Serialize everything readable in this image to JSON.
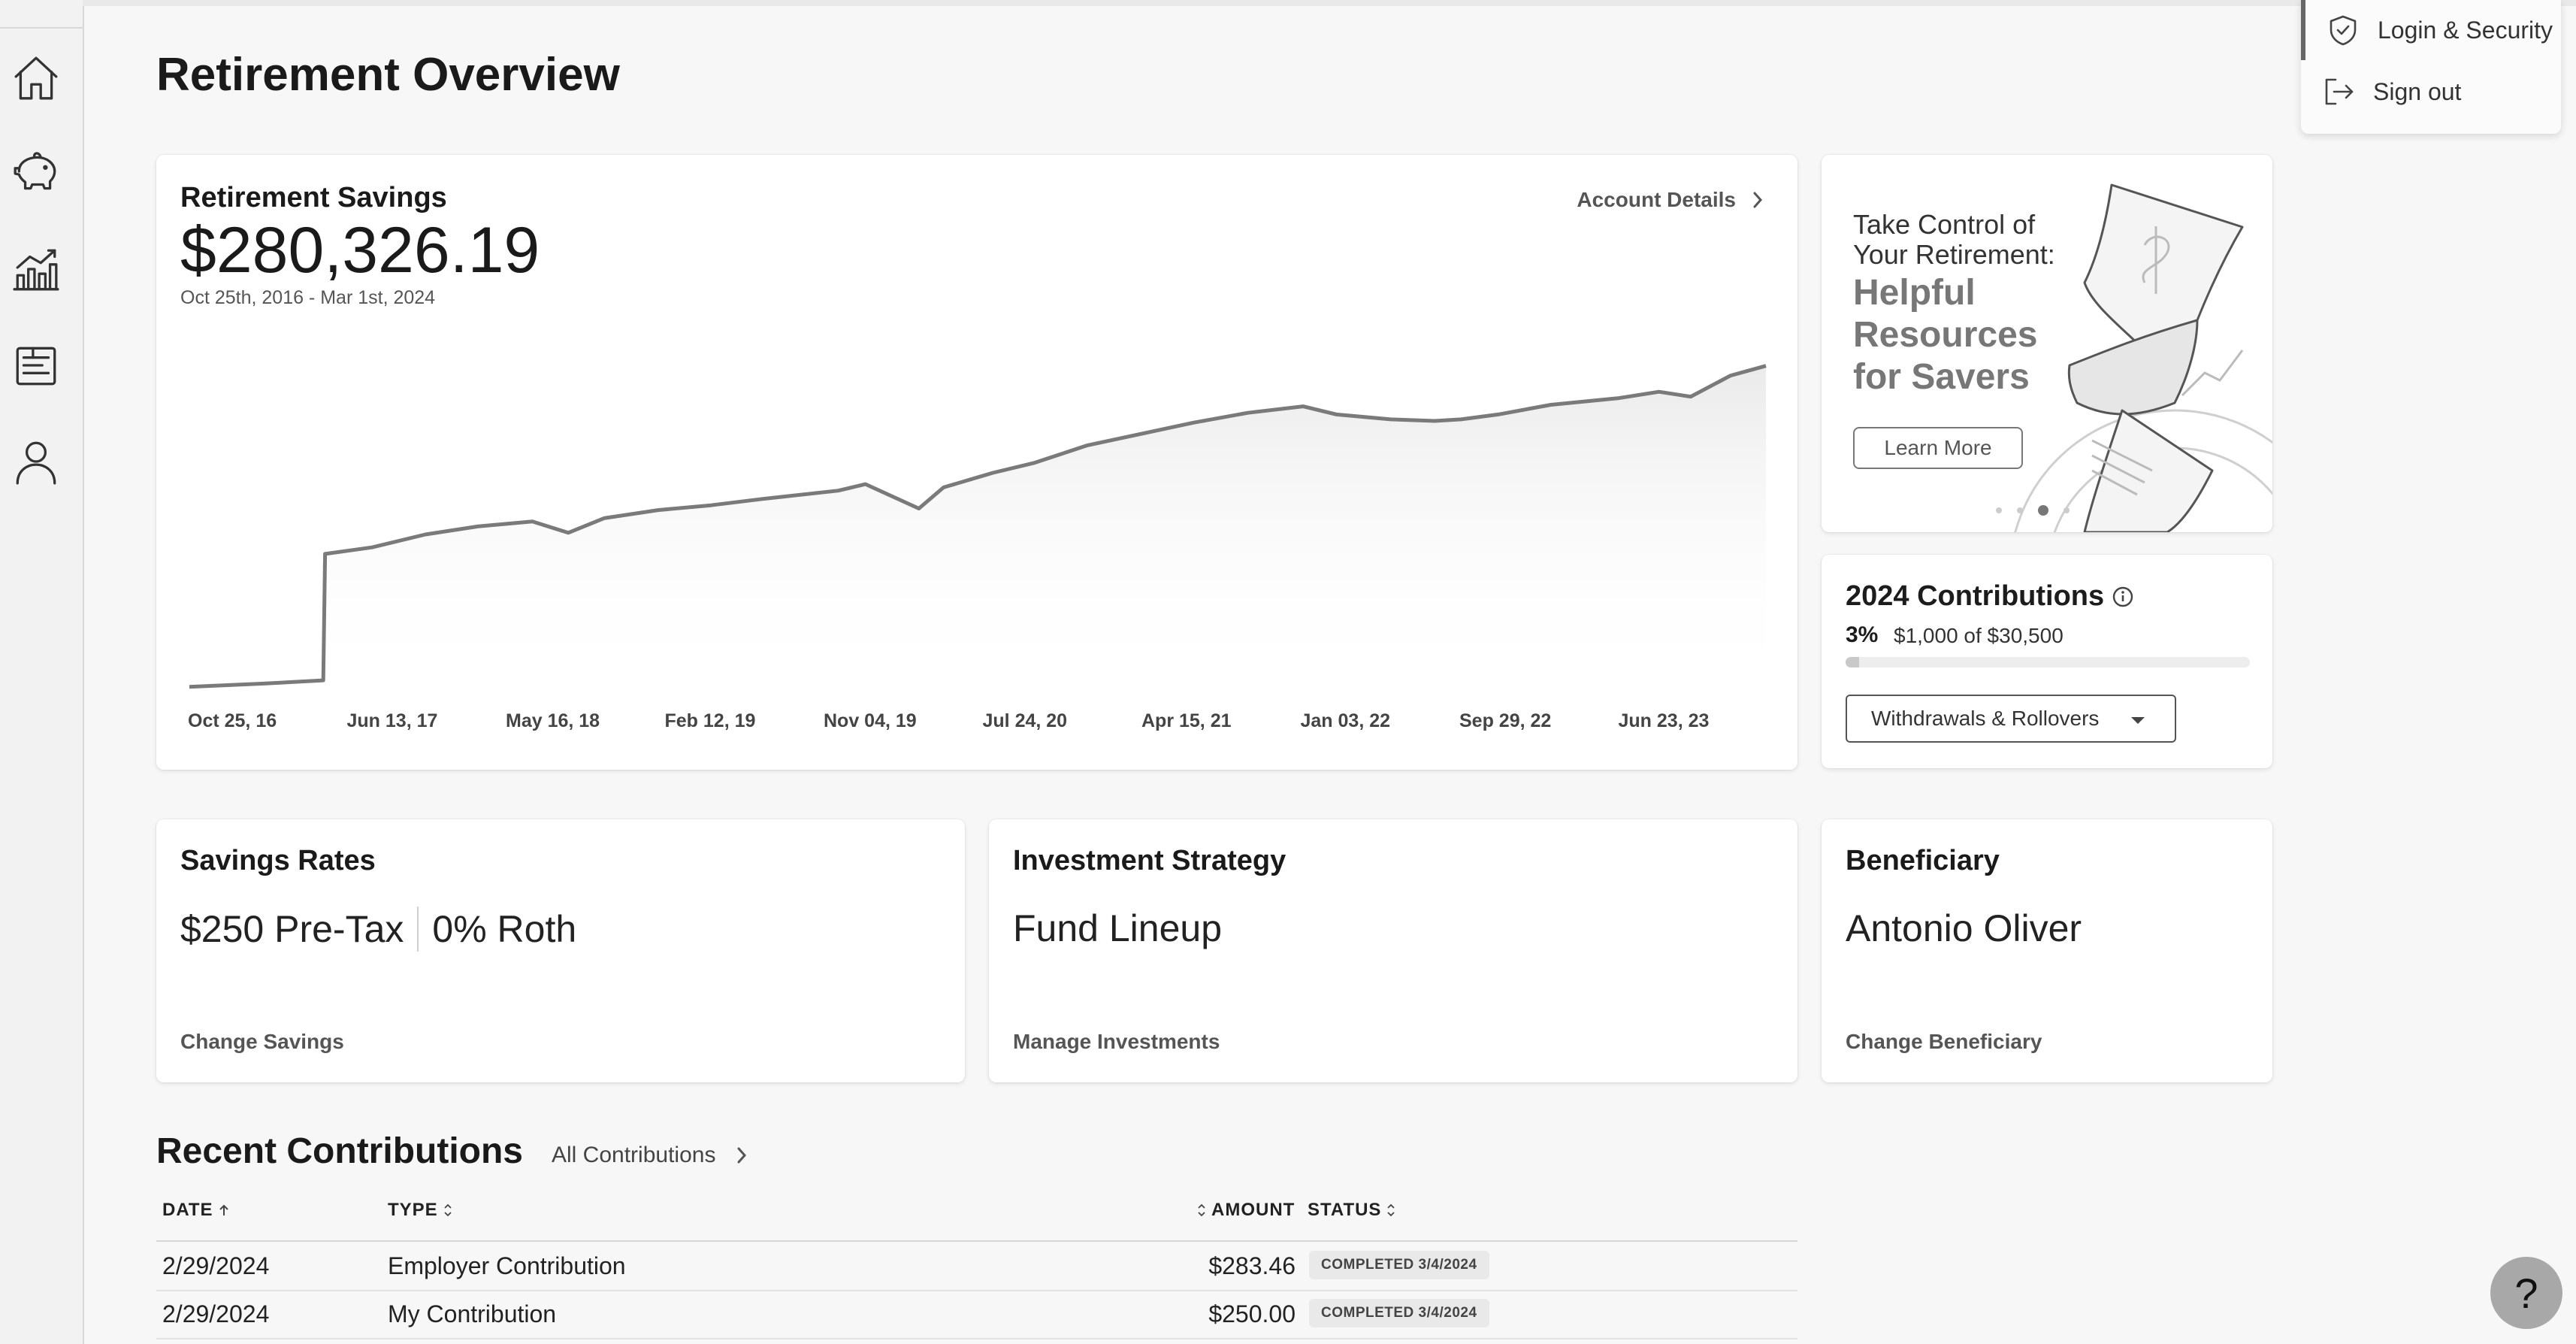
{
  "page": {
    "title": "Retirement Overview"
  },
  "sidebar": {
    "items": [
      {
        "name": "home",
        "icon": "home-icon"
      },
      {
        "name": "savings",
        "icon": "piggy-bank-icon"
      },
      {
        "name": "investments",
        "icon": "bar-chart-icon"
      },
      {
        "name": "documents",
        "icon": "document-icon"
      },
      {
        "name": "profile",
        "icon": "user-icon"
      }
    ]
  },
  "user_menu": {
    "items": [
      {
        "label": "Login & Security",
        "icon": "shield-check-icon",
        "active": true
      },
      {
        "label": "Sign out",
        "icon": "sign-out-icon",
        "active": false
      }
    ]
  },
  "savings": {
    "title": "Retirement Savings",
    "balance": "$280,326.19",
    "range": "Oct 25th, 2016 - Mar 1st, 2024",
    "details_link": "Account Details"
  },
  "chart_data": {
    "type": "area",
    "title": "Retirement Savings",
    "x_tick_labels": [
      "Oct 25, 16",
      "Jun 13, 17",
      "May 16, 18",
      "Feb 12, 19",
      "Nov 04, 19",
      "Jul 24, 20",
      "Apr 15, 21",
      "Jan 03, 22",
      "Sep 29, 22",
      "Jun 23, 23"
    ],
    "x": [
      "2016-10-25",
      "2017-03-01",
      "2017-06-10",
      "2017-06-13",
      "2017-09-01",
      "2017-12-01",
      "2018-03-01",
      "2018-06-01",
      "2018-08-01",
      "2018-10-01",
      "2019-01-01",
      "2019-04-01",
      "2019-07-01",
      "2019-11-04",
      "2019-12-20",
      "2020-03-20",
      "2020-05-01",
      "2020-07-24",
      "2020-10-01",
      "2021-01-01",
      "2021-04-15",
      "2021-07-01",
      "2021-10-01",
      "2022-01-03",
      "2022-03-01",
      "2022-06-01",
      "2022-08-15",
      "2022-09-29",
      "2022-12-01",
      "2023-03-01",
      "2023-06-23",
      "2023-09-01",
      "2023-10-25",
      "2024-01-01",
      "2024-03-01"
    ],
    "y": [
      2000,
      4000,
      6000,
      84000,
      88000,
      96000,
      101000,
      104000,
      97000,
      106000,
      111000,
      114000,
      118000,
      123000,
      127000,
      112000,
      125000,
      134000,
      140000,
      151000,
      159000,
      165000,
      171000,
      175000,
      170000,
      167000,
      166000,
      167000,
      170000,
      176000,
      180000,
      184000,
      181000,
      194000,
      200000
    ],
    "ylim": [
      0,
      230000
    ],
    "grid": false,
    "xlabel": "",
    "ylabel": ""
  },
  "promo": {
    "line1": "Take Control of",
    "line2": "Your Retirement:",
    "big1": "Helpful",
    "big2": "Resources",
    "big3": "for Savers",
    "button": "Learn More",
    "slides": 4,
    "active_slide": 3
  },
  "contributions": {
    "title": "2024 Contributions",
    "percent": "3%",
    "amounts": "$1,000 of $30,500",
    "progress": 0.0328,
    "select_value": "Withdrawals & Rollovers"
  },
  "rates": {
    "title": "Savings Rates",
    "pretax": "$250 Pre-Tax",
    "roth": "0% Roth",
    "link": "Change Savings"
  },
  "strategy": {
    "title": "Investment Strategy",
    "value": "Fund Lineup",
    "link": "Manage Investments"
  },
  "beneficiary": {
    "title": "Beneficiary",
    "value": "Antonio Oliver",
    "link": "Change Beneficiary"
  },
  "recent": {
    "title": "Recent Contributions",
    "all_link": "All Contributions",
    "columns": {
      "date": "DATE",
      "type": "TYPE",
      "amount": "AMOUNT",
      "status": "STATUS"
    },
    "rows": [
      {
        "date": "2/29/2024",
        "type": "Employer Contribution",
        "amount": "$283.46",
        "status": "COMPLETED 3/4/2024"
      },
      {
        "date": "2/29/2024",
        "type": "My Contribution",
        "amount": "$250.00",
        "status": "COMPLETED 3/4/2024"
      }
    ]
  },
  "help": {
    "label": "?"
  },
  "colors": {
    "accent": "#777777",
    "line": "#7a7a7a",
    "card_bg": "#ffffff",
    "page_bg": "#f7f7f7"
  }
}
